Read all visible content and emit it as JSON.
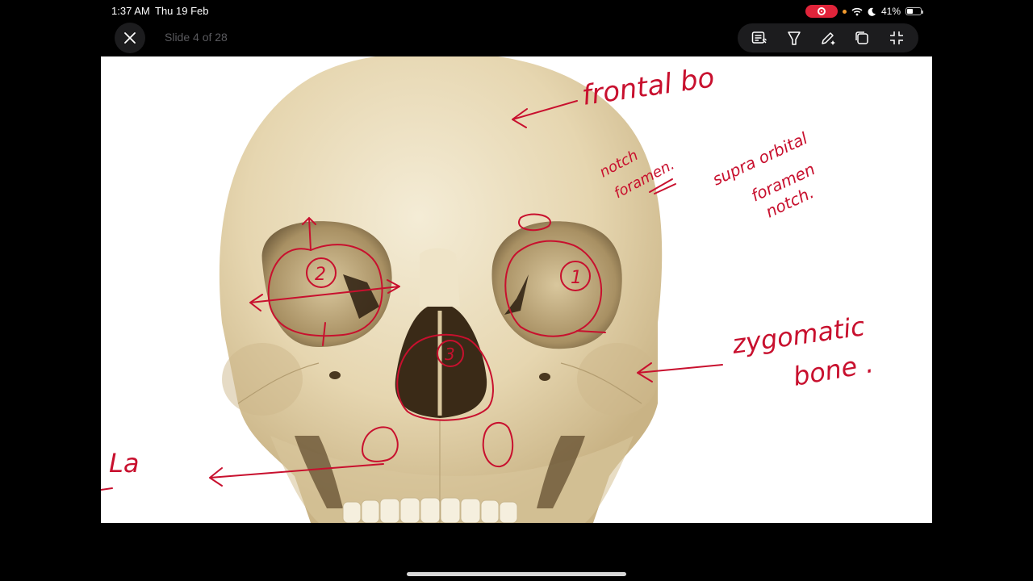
{
  "status_bar": {
    "time": "1:37 AM",
    "date": "Thu 19 Feb",
    "battery": "41%"
  },
  "header": {
    "slide_counter": "Slide 4 of 28"
  },
  "toolbar": {
    "icons": [
      "notes-icon",
      "pen-tip-icon",
      "magic-pencil-icon",
      "duplicate-icon",
      "fullscreen-icon"
    ]
  },
  "slide": {
    "annotations": {
      "frontal": "frontal bo",
      "notch_foramen_a": "notch",
      "notch_foramen_b": "foramen.",
      "supra_line1": "supra orbital",
      "supra_line2": "foramen",
      "supra_line3": "notch.",
      "zygomatic_line1": "zygomatic",
      "zygomatic_line2": "bone .",
      "left_edge": "La",
      "orbit_right_num": "2",
      "orbit_left_num": "1",
      "nasal_num": "3"
    },
    "annotation_color": "#c8102e"
  },
  "colors": {
    "background": "#000000",
    "rec_pill": "#e0243a",
    "bone": "#e9dcbc"
  }
}
